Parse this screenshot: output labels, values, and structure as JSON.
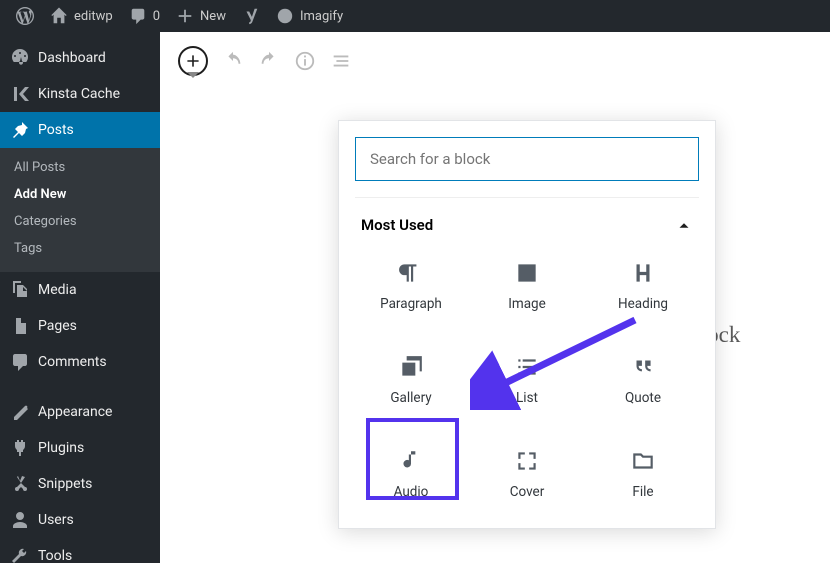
{
  "adminbar": {
    "site_name": "editwp",
    "comments_count": "0",
    "new_label": "New",
    "imagify_label": "Imagify"
  },
  "sidebar": {
    "items": [
      {
        "label": "Dashboard"
      },
      {
        "label": "Kinsta Cache"
      },
      {
        "label": "Posts"
      },
      {
        "label": "Media"
      },
      {
        "label": "Pages"
      },
      {
        "label": "Comments"
      },
      {
        "label": "Appearance"
      },
      {
        "label": "Plugins"
      },
      {
        "label": "Snippets"
      },
      {
        "label": "Users"
      },
      {
        "label": "Tools"
      }
    ],
    "posts_submenu": [
      {
        "label": "All Posts"
      },
      {
        "label": "Add New"
      },
      {
        "label": "Categories"
      },
      {
        "label": "Tags"
      }
    ]
  },
  "editor": {
    "background_text": "to choose a block"
  },
  "inserter": {
    "search_placeholder": "Search for a block",
    "section_label": "Most Used",
    "blocks": [
      {
        "label": "Paragraph"
      },
      {
        "label": "Image"
      },
      {
        "label": "Heading"
      },
      {
        "label": "Gallery"
      },
      {
        "label": "List"
      },
      {
        "label": "Quote"
      },
      {
        "label": "Audio"
      },
      {
        "label": "Cover"
      },
      {
        "label": "File"
      }
    ]
  },
  "annotation": {
    "highlighted_block": "Audio",
    "highlight_color": "#5333ed"
  }
}
